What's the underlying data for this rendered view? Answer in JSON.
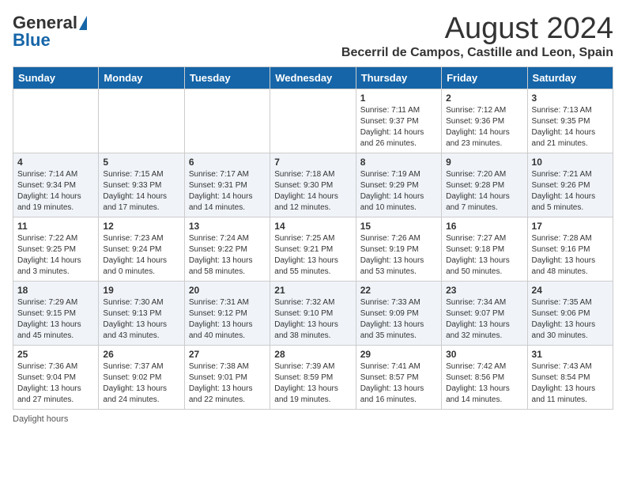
{
  "header": {
    "logo_general": "General",
    "logo_blue": "Blue",
    "title": "August 2024",
    "subtitle": "Becerril de Campos, Castille and Leon, Spain"
  },
  "columns": [
    "Sunday",
    "Monday",
    "Tuesday",
    "Wednesday",
    "Thursday",
    "Friday",
    "Saturday"
  ],
  "weeks": [
    [
      {
        "day": "",
        "content": ""
      },
      {
        "day": "",
        "content": ""
      },
      {
        "day": "",
        "content": ""
      },
      {
        "day": "",
        "content": ""
      },
      {
        "day": "1",
        "content": "Sunrise: 7:11 AM\nSunset: 9:37 PM\nDaylight: 14 hours\nand 26 minutes."
      },
      {
        "day": "2",
        "content": "Sunrise: 7:12 AM\nSunset: 9:36 PM\nDaylight: 14 hours\nand 23 minutes."
      },
      {
        "day": "3",
        "content": "Sunrise: 7:13 AM\nSunset: 9:35 PM\nDaylight: 14 hours\nand 21 minutes."
      }
    ],
    [
      {
        "day": "4",
        "content": "Sunrise: 7:14 AM\nSunset: 9:34 PM\nDaylight: 14 hours\nand 19 minutes."
      },
      {
        "day": "5",
        "content": "Sunrise: 7:15 AM\nSunset: 9:33 PM\nDaylight: 14 hours\nand 17 minutes."
      },
      {
        "day": "6",
        "content": "Sunrise: 7:17 AM\nSunset: 9:31 PM\nDaylight: 14 hours\nand 14 minutes."
      },
      {
        "day": "7",
        "content": "Sunrise: 7:18 AM\nSunset: 9:30 PM\nDaylight: 14 hours\nand 12 minutes."
      },
      {
        "day": "8",
        "content": "Sunrise: 7:19 AM\nSunset: 9:29 PM\nDaylight: 14 hours\nand 10 minutes."
      },
      {
        "day": "9",
        "content": "Sunrise: 7:20 AM\nSunset: 9:28 PM\nDaylight: 14 hours\nand 7 minutes."
      },
      {
        "day": "10",
        "content": "Sunrise: 7:21 AM\nSunset: 9:26 PM\nDaylight: 14 hours\nand 5 minutes."
      }
    ],
    [
      {
        "day": "11",
        "content": "Sunrise: 7:22 AM\nSunset: 9:25 PM\nDaylight: 14 hours\nand 3 minutes."
      },
      {
        "day": "12",
        "content": "Sunrise: 7:23 AM\nSunset: 9:24 PM\nDaylight: 14 hours\nand 0 minutes."
      },
      {
        "day": "13",
        "content": "Sunrise: 7:24 AM\nSunset: 9:22 PM\nDaylight: 13 hours\nand 58 minutes."
      },
      {
        "day": "14",
        "content": "Sunrise: 7:25 AM\nSunset: 9:21 PM\nDaylight: 13 hours\nand 55 minutes."
      },
      {
        "day": "15",
        "content": "Sunrise: 7:26 AM\nSunset: 9:19 PM\nDaylight: 13 hours\nand 53 minutes."
      },
      {
        "day": "16",
        "content": "Sunrise: 7:27 AM\nSunset: 9:18 PM\nDaylight: 13 hours\nand 50 minutes."
      },
      {
        "day": "17",
        "content": "Sunrise: 7:28 AM\nSunset: 9:16 PM\nDaylight: 13 hours\nand 48 minutes."
      }
    ],
    [
      {
        "day": "18",
        "content": "Sunrise: 7:29 AM\nSunset: 9:15 PM\nDaylight: 13 hours\nand 45 minutes."
      },
      {
        "day": "19",
        "content": "Sunrise: 7:30 AM\nSunset: 9:13 PM\nDaylight: 13 hours\nand 43 minutes."
      },
      {
        "day": "20",
        "content": "Sunrise: 7:31 AM\nSunset: 9:12 PM\nDaylight: 13 hours\nand 40 minutes."
      },
      {
        "day": "21",
        "content": "Sunrise: 7:32 AM\nSunset: 9:10 PM\nDaylight: 13 hours\nand 38 minutes."
      },
      {
        "day": "22",
        "content": "Sunrise: 7:33 AM\nSunset: 9:09 PM\nDaylight: 13 hours\nand 35 minutes."
      },
      {
        "day": "23",
        "content": "Sunrise: 7:34 AM\nSunset: 9:07 PM\nDaylight: 13 hours\nand 32 minutes."
      },
      {
        "day": "24",
        "content": "Sunrise: 7:35 AM\nSunset: 9:06 PM\nDaylight: 13 hours\nand 30 minutes."
      }
    ],
    [
      {
        "day": "25",
        "content": "Sunrise: 7:36 AM\nSunset: 9:04 PM\nDaylight: 13 hours\nand 27 minutes."
      },
      {
        "day": "26",
        "content": "Sunrise: 7:37 AM\nSunset: 9:02 PM\nDaylight: 13 hours\nand 24 minutes."
      },
      {
        "day": "27",
        "content": "Sunrise: 7:38 AM\nSunset: 9:01 PM\nDaylight: 13 hours\nand 22 minutes."
      },
      {
        "day": "28",
        "content": "Sunrise: 7:39 AM\nSunset: 8:59 PM\nDaylight: 13 hours\nand 19 minutes."
      },
      {
        "day": "29",
        "content": "Sunrise: 7:41 AM\nSunset: 8:57 PM\nDaylight: 13 hours\nand 16 minutes."
      },
      {
        "day": "30",
        "content": "Sunrise: 7:42 AM\nSunset: 8:56 PM\nDaylight: 13 hours\nand 14 minutes."
      },
      {
        "day": "31",
        "content": "Sunrise: 7:43 AM\nSunset: 8:54 PM\nDaylight: 13 hours\nand 11 minutes."
      }
    ]
  ],
  "footer": {
    "daylight_hours": "Daylight hours"
  }
}
